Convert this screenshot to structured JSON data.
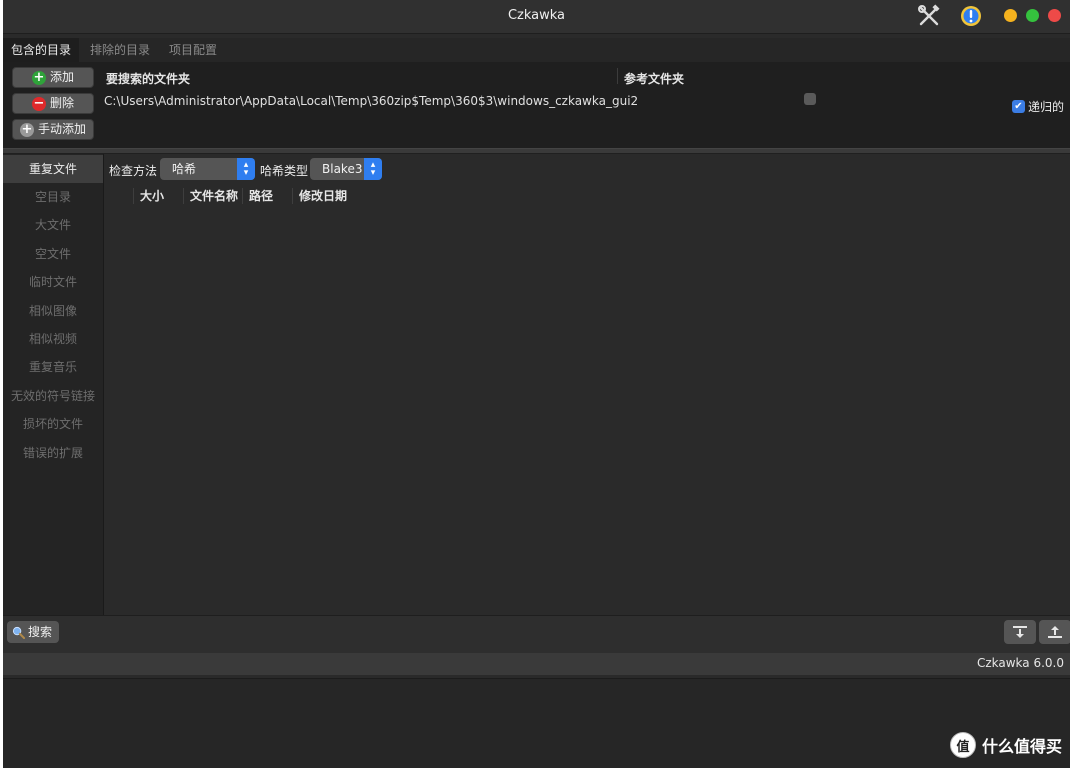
{
  "window": {
    "title": "Czkawka"
  },
  "tabs": [
    {
      "label": "包含的目录",
      "active": true
    },
    {
      "label": "排除的目录",
      "active": false
    },
    {
      "label": "项目配置",
      "active": false
    }
  ],
  "dir_panel": {
    "buttons": {
      "add": "添加",
      "remove": "删除",
      "manual_add": "手动添加"
    },
    "col_search": "要搜索的文件夹",
    "col_reference": "参考文件夹",
    "path": "C:\\Users\\Administrator\\AppData\\Local\\Temp\\360zip$Temp\\360$3\\windows_czkawka_gui2",
    "reference_checked": false,
    "recursive_label": "递归的",
    "recursive_checked": true
  },
  "nav": {
    "items": [
      {
        "label": "重复文件",
        "active": true
      },
      {
        "label": "空目录"
      },
      {
        "label": "大文件"
      },
      {
        "label": "空文件"
      },
      {
        "label": "临时文件"
      },
      {
        "label": "相似图像"
      },
      {
        "label": "相似视频"
      },
      {
        "label": "重复音乐"
      },
      {
        "label": "无效的符号链接"
      },
      {
        "label": "损坏的文件"
      },
      {
        "label": "错误的扩展"
      }
    ]
  },
  "main": {
    "check_method_label": "检查方法",
    "check_method_value": "哈希",
    "hash_type_label": "哈希类型",
    "hash_type_value": "Blake3",
    "columns": [
      "大小",
      "文件名称",
      "路径",
      "修改日期"
    ]
  },
  "bottom": {
    "search_label": "搜索"
  },
  "status": {
    "version": "Czkawka 6.0.0"
  },
  "watermark": {
    "badge": "值",
    "text": "什么值得买"
  },
  "colors": {
    "accent": "#2f7ef0",
    "add_green": "#2fa33a",
    "remove_red": "#e0292b",
    "dot_yellow": "#f5b21e",
    "dot_green": "#35c23e",
    "dot_red": "#ee4a48"
  }
}
